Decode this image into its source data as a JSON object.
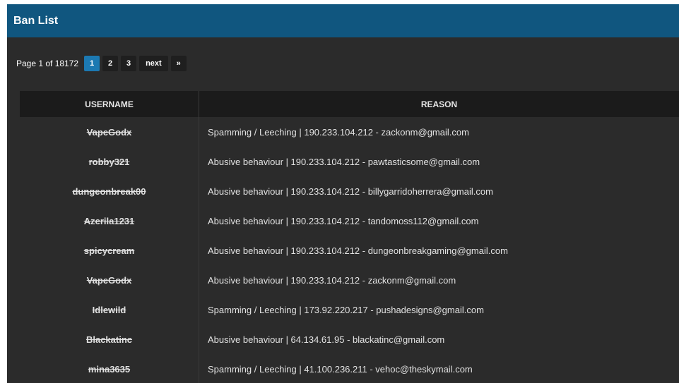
{
  "panel": {
    "title": "Ban List"
  },
  "pagination": {
    "info": "Page 1 of 18172",
    "pages": [
      "1",
      "2",
      "3"
    ],
    "active": "1",
    "next_label": "next",
    "last_label": "»"
  },
  "table": {
    "headers": {
      "username": "USERNAME",
      "reason": "REASON"
    },
    "rows": [
      {
        "username": "VapeGodx",
        "reason": "Spamming / Leeching | 190.233.104.212 - zackonm@gmail.com"
      },
      {
        "username": "robby321",
        "reason": "Abusive behaviour | 190.233.104.212 - pawtasticsome@gmail.com"
      },
      {
        "username": "dungeonbreak00",
        "reason": "Abusive behaviour | 190.233.104.212 - billygarridoherrera@gmail.com"
      },
      {
        "username": "Azerila1231",
        "reason": "Abusive behaviour | 190.233.104.212 - tandomoss112@gmail.com"
      },
      {
        "username": "spicycream",
        "reason": "Abusive behaviour | 190.233.104.212 - dungeonbreakgaming@gmail.com"
      },
      {
        "username": "VapeGodx",
        "reason": "Abusive behaviour | 190.233.104.212 - zackonm@gmail.com"
      },
      {
        "username": "Idlewild",
        "reason": "Spamming / Leeching | 173.92.220.217 - pushadesigns@gmail.com"
      },
      {
        "username": "Blackatinc",
        "reason": "Abusive behaviour | 64.134.61.95 - blackatinc@gmail.com"
      },
      {
        "username": "mina3635",
        "reason": "Spamming / Leeching | 41.100.236.211 - vehoc@theskymail.com"
      }
    ]
  },
  "colors": {
    "header_bg": "#10567f",
    "panel_bg": "#2b2b2b",
    "active_page": "#1c79b2"
  }
}
